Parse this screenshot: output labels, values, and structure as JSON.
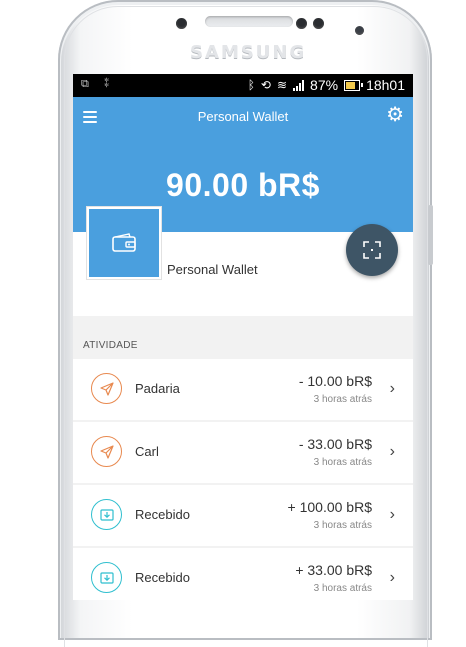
{
  "device": {
    "brand": "SAMSUNG"
  },
  "status_bar": {
    "battery": "87%",
    "time": "18h01"
  },
  "header": {
    "title": "Personal Wallet",
    "balance": "90.00 bR$"
  },
  "wallet": {
    "name": "Personal Wallet"
  },
  "activity": {
    "label": "ATIVIDADE",
    "items": [
      {
        "name": "Padaria",
        "amount": "- 10.00 bR$",
        "time": "3 horas atrás",
        "kind": "sent"
      },
      {
        "name": "Carl",
        "amount": "- 33.00 bR$",
        "time": "3 horas atrás",
        "kind": "sent"
      },
      {
        "name": "Recebido",
        "amount": "+ 100.00 bR$",
        "time": "3 horas atrás",
        "kind": "received"
      },
      {
        "name": "Recebido",
        "amount": "+ 33.00 bR$",
        "time": "3 horas atrás",
        "kind": "received"
      }
    ]
  },
  "colors": {
    "header": "#4a9fde",
    "sent": "#e8894f",
    "received": "#2fbfcf",
    "scan_button": "#3e5566"
  }
}
